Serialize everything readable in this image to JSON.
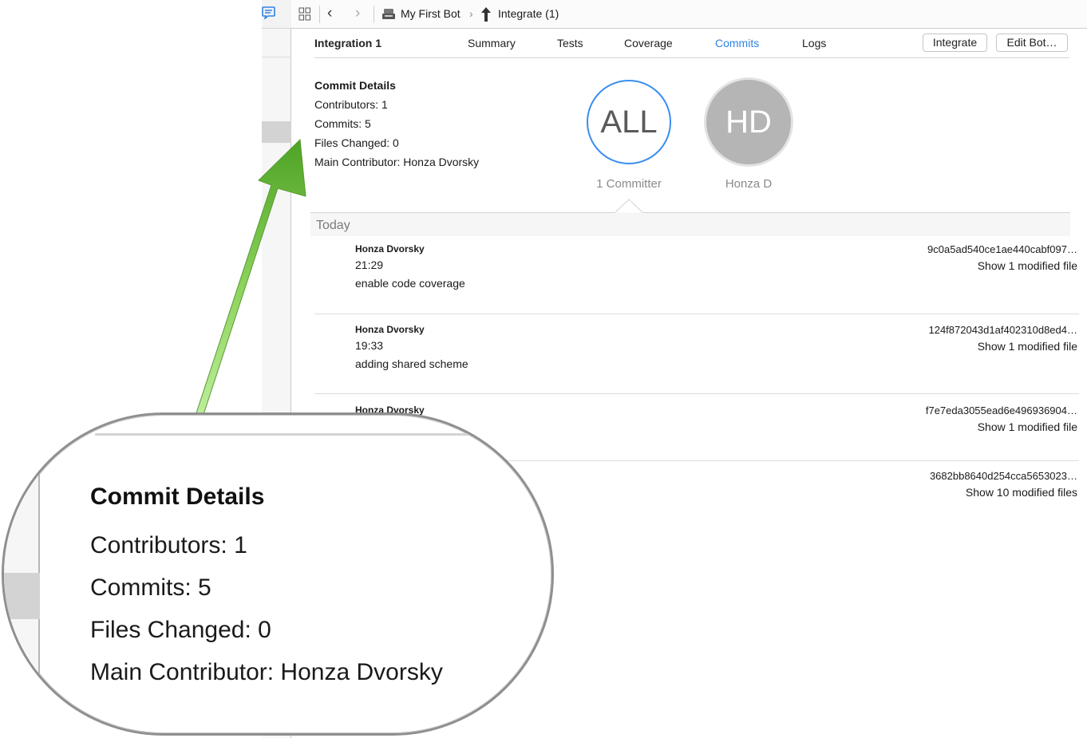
{
  "toolbar": {
    "breadcrumb_bot": "My First Bot",
    "breadcrumb_integration": "Integrate (1)"
  },
  "tabs": {
    "title": "Integration 1",
    "items": [
      "Summary",
      "Tests",
      "Coverage",
      "Commits",
      "Logs"
    ],
    "active": "Commits",
    "integrate_button": "Integrate",
    "edit_bot_button": "Edit Bot…"
  },
  "details": {
    "heading": "Commit Details",
    "contributors": "Contributors: 1",
    "commits": "Commits: 5",
    "files_changed": "Files Changed: 0",
    "main_contributor": "Main Contributor: Honza Dvorsky"
  },
  "committers": {
    "all_label": "ALL",
    "all_caption": "1 Committer",
    "hd_initials": "HD",
    "hd_caption": "Honza D"
  },
  "commits_section": {
    "date_header": "Today",
    "items": [
      {
        "author": "Honza Dvorsky",
        "time": "21:29",
        "message": "enable code coverage",
        "hash": "9c0a5ad540ce1ae440cabf097…",
        "files": "Show 1 modified file"
      },
      {
        "author": "Honza Dvorsky",
        "time": "19:33",
        "message": "adding shared scheme",
        "hash": "124f872043d1af402310d8ed4…",
        "files": "Show 1 modified file"
      },
      {
        "author": "Honza Dvorsky",
        "hash": "f7e7eda3055ead6e496936904…",
        "files": "Show 1 modified file"
      },
      {
        "hash": "3682bb8640d254cca5653023…",
        "files": "Show 10 modified files"
      }
    ]
  },
  "colors": {
    "accent": "#2f84e6",
    "arrow": "#6cbf3a",
    "avatar": "#b5b5b5"
  }
}
